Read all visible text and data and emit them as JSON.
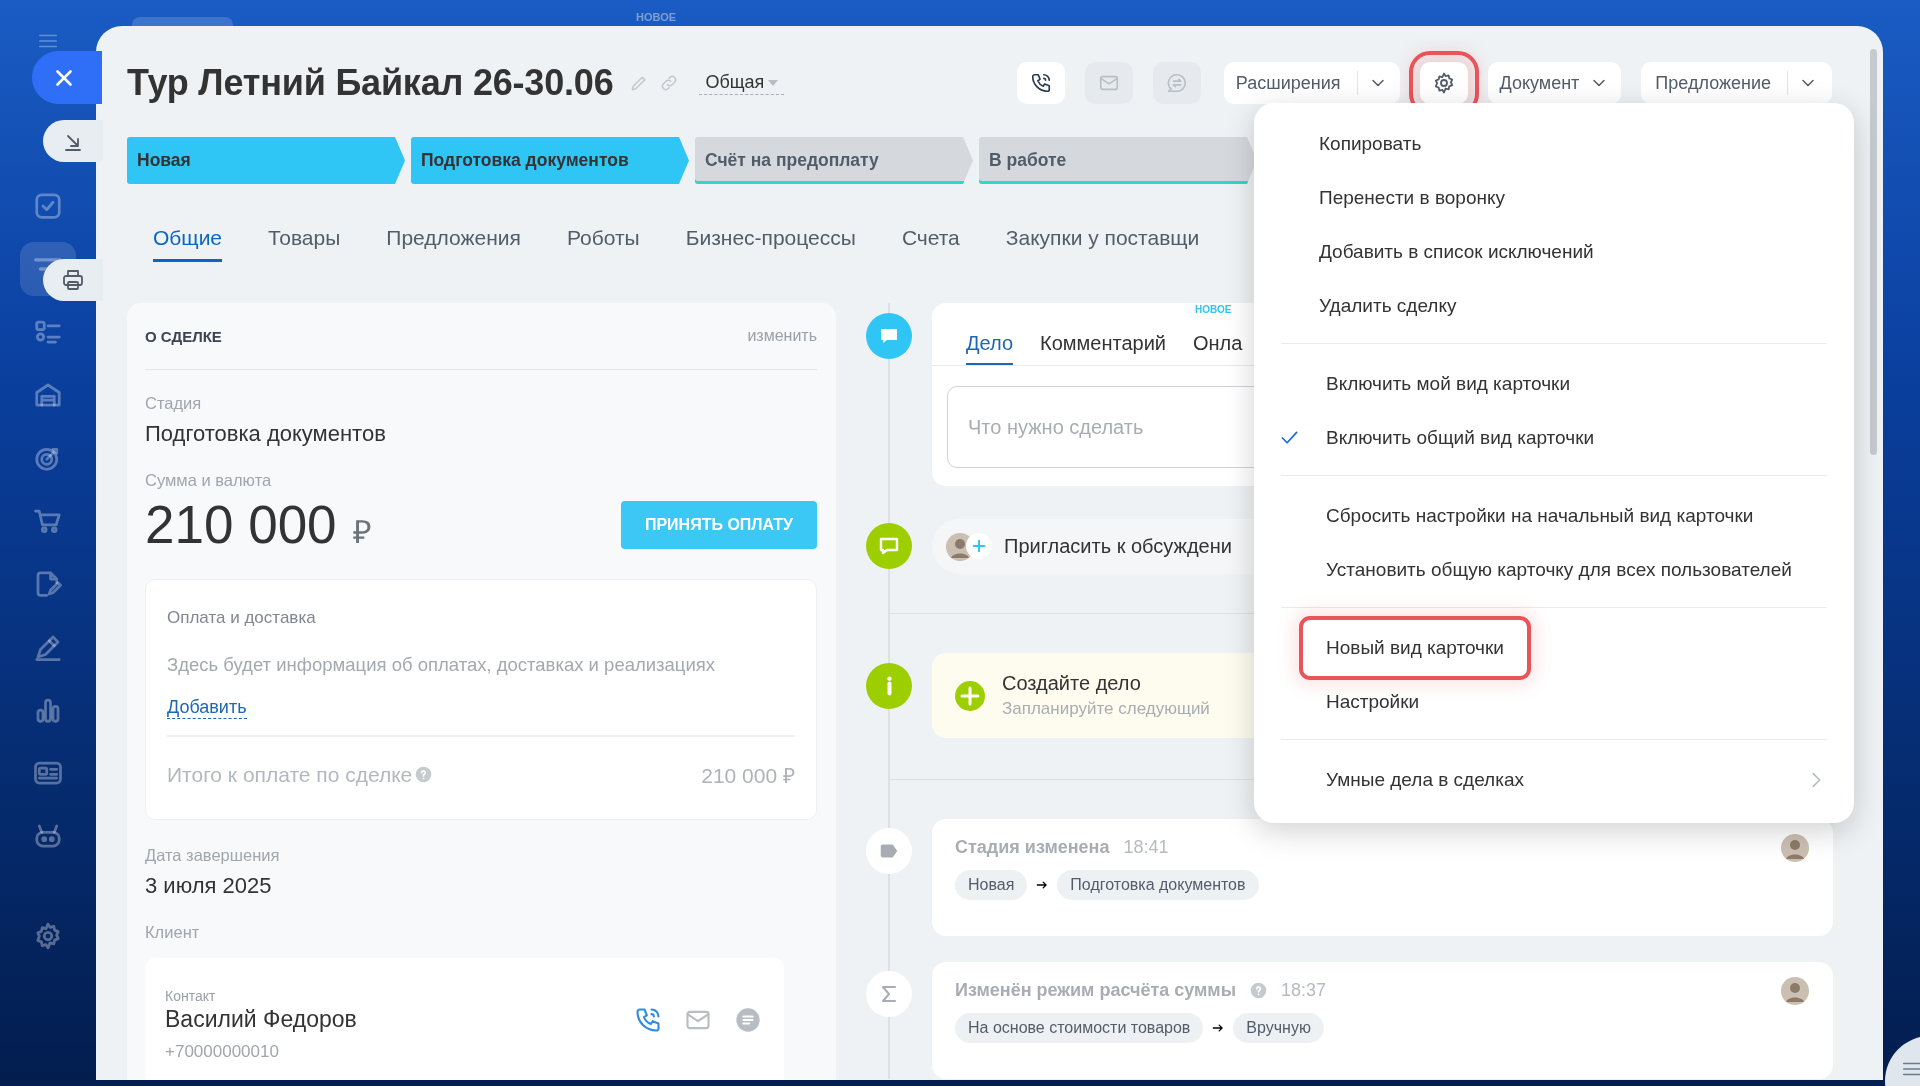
{
  "sidebar": {
    "items": [
      {
        "selected": false
      },
      {
        "selected": true
      },
      {
        "selected": false
      },
      {
        "selected": false
      },
      {
        "selected": false
      },
      {
        "selected": false
      },
      {
        "selected": false
      },
      {
        "selected": false
      },
      {
        "selected": false
      },
      {
        "selected": false
      },
      {
        "selected": false
      },
      {
        "selected": false
      }
    ]
  },
  "top_badge": "НОВОЕ",
  "header": {
    "title": "Тур Летний Байкал 26-30.06",
    "category": "Общая",
    "contact_buttons": [
      {
        "disabled": false
      },
      {
        "disabled": true
      },
      {
        "disabled": true
      }
    ],
    "extensions_button": "Расширения",
    "settings_button": {
      "highlighted": true
    },
    "document_button": "Документ",
    "offer_button": "Предложение"
  },
  "stages": [
    {
      "label": "Новая",
      "passed": true
    },
    {
      "label": "Подготовка документов",
      "passed": true
    },
    {
      "label": "Счёт на предоплату",
      "passed": false
    },
    {
      "label": "В работе",
      "passed": false
    }
  ],
  "tabs": [
    {
      "label": "Общие",
      "selected": true
    },
    {
      "label": "Товары",
      "selected": false
    },
    {
      "label": "Предложения",
      "selected": false
    },
    {
      "label": "Роботы",
      "selected": false
    },
    {
      "label": "Бизнес-процессы",
      "selected": false
    },
    {
      "label": "Счета",
      "selected": false
    },
    {
      "label": "Закупки у поставщи",
      "selected": false
    }
  ],
  "deal": {
    "title": "О СДЕЛКЕ",
    "edit_link": "изменить",
    "stage_label": "Стадия",
    "stage_value": "Подготовка документов",
    "amount_label": "Сумма и валюта",
    "amount": "210 000",
    "currency": "₽",
    "pay_button": "ПРИНЯТЬ ОПЛАТУ",
    "payment": {
      "title": "Оплата и доставка",
      "text": "Здесь будет информация об оплатах, доставках и реализациях",
      "add_link": "Добавить",
      "total_label": "Итого к оплате по сделке",
      "total_value": "210 000 ₽"
    },
    "close_date_label": "Дата завершения",
    "close_date": "3 июля 2025",
    "client_label": "Клиент",
    "contact": {
      "label": "Контакт",
      "name": "Василий Федоров",
      "phone": "+70000000010"
    }
  },
  "timeline": {
    "composer": {
      "tabs": [
        {
          "label": "Дело",
          "selected": true
        },
        {
          "label": "Комментарий",
          "selected": false
        },
        {
          "label": "Онла",
          "selected": false,
          "badge": "НОВОЕ"
        }
      ],
      "placeholder": "Что нужно сделать"
    },
    "invite": "Пригласить к обсуждени",
    "todo": {
      "title": "Создайте дело",
      "subtitle": "Запланируйте следующий"
    },
    "history": [
      {
        "kind": "stage",
        "title": "Стадия изменена",
        "time": "18:41",
        "from": "Новая",
        "to": "Подготовка документов",
        "help": false
      },
      {
        "kind": "sum",
        "title": "Изменён режим расчёта суммы",
        "time": "18:37",
        "from": "На основе стоимости товаров",
        "to": "Вручную",
        "help": true
      }
    ]
  },
  "settings_menu": {
    "groups": [
      {
        "items": [
          {
            "label": "Копировать"
          },
          {
            "label": "Перенести в воронку"
          },
          {
            "label": "Добавить в список исключений"
          },
          {
            "label": "Удалить сделку"
          }
        ]
      },
      {
        "items": [
          {
            "label": "Включить мой вид карточки",
            "checked": false
          },
          {
            "label": "Включить общий вид карточки",
            "checked": true
          }
        ]
      },
      {
        "items": [
          {
            "label": "Сбросить настройки на начальный вид карточки"
          },
          {
            "label": "Установить общую карточку для всех пользователей"
          }
        ]
      },
      {
        "items": [
          {
            "label": "Новый вид карточки",
            "highlighted": true
          },
          {
            "label": "Настройки",
            "highlighted": false
          }
        ]
      },
      {
        "items": [
          {
            "label": "Умные дела в сделках",
            "submenu": true
          }
        ]
      }
    ]
  }
}
